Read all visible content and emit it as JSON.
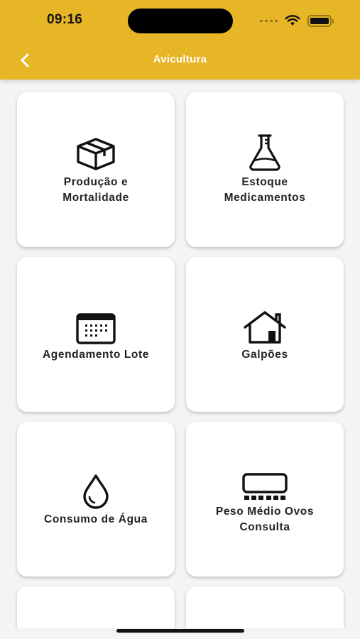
{
  "status_bar": {
    "time": "09:16"
  },
  "header": {
    "title": "Avicultura"
  },
  "colors": {
    "header_bg": "#e7b626",
    "title": "#ffffff",
    "card_bg": "#ffffff",
    "text": "#222222"
  },
  "cards": [
    {
      "label": "Produção e\nMortalidade",
      "icon": "box-icon"
    },
    {
      "label": "Estoque\nMedicamentos",
      "icon": "flask-icon"
    },
    {
      "label": "Agendamento Lote",
      "icon": "calendar-icon"
    },
    {
      "label": "Galpões",
      "icon": "house-icon"
    },
    {
      "label": "Consumo de Água",
      "icon": "water-drop-icon"
    },
    {
      "label": "Peso Médio Ovos\nConsulta",
      "icon": "scale-icon"
    }
  ]
}
